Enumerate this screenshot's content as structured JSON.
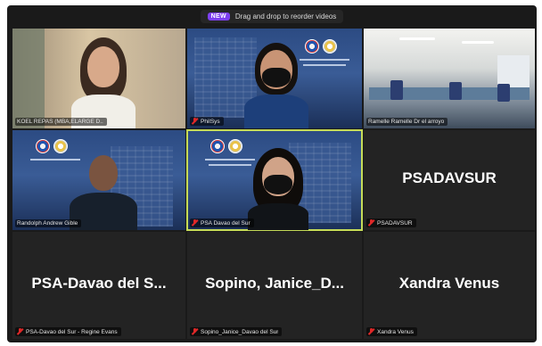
{
  "toolbar": {
    "new_badge": "NEW",
    "drag_hint": "Drag and drop to reorder videos"
  },
  "participants": [
    {
      "name": "KOEL REPAS (MBA,ELARGE D..",
      "muted": true,
      "video": true
    },
    {
      "name": "PhilSys",
      "muted": true,
      "video": true
    },
    {
      "name": "Ramelle Ramelle Dr el arroyo",
      "muted": false,
      "video": true
    },
    {
      "name": "Randolph Andrew Gible",
      "muted": false,
      "video": true
    },
    {
      "name": "PSA Davao del Sur",
      "muted": true,
      "video": true,
      "active_speaker": true
    },
    {
      "display": "PSADAVSUR",
      "name": "PSADAVSUR",
      "muted": true,
      "video": false
    },
    {
      "display": "PSA-Davao del S...",
      "name": "PSA-Davao del Sur - Regine Evans",
      "muted": true,
      "video": false
    },
    {
      "display": "Sopino, Janice_D...",
      "name": "Sopino_Janice_Davao del Sur",
      "muted": true,
      "video": false
    },
    {
      "display": "Xandra Venus",
      "name": "Xandra Venus",
      "muted": true,
      "video": false
    }
  ],
  "colors": {
    "tile_bg": "#232323",
    "active_outline": "#c6dc58",
    "muted_mic": "#e02828",
    "new_badge": "#7d3ff0"
  },
  "icons": [
    "muted-mic-icon"
  ]
}
